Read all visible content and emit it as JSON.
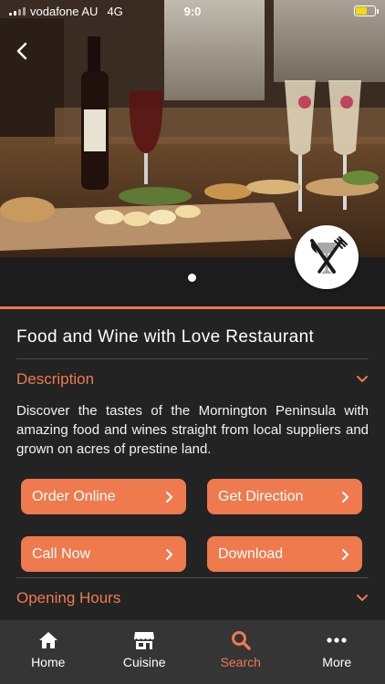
{
  "status": {
    "carrier": "vodafone AU",
    "network": "4G",
    "time": "9:0",
    "battery_level": 0.6
  },
  "colors": {
    "accent": "#ee7a4e",
    "background": "#232323",
    "tabbar": "#353535"
  },
  "hero": {
    "back_icon": "chevron-left-icon",
    "badge_icon": "knife-fork-wine-icon",
    "carousel_pages": 1,
    "carousel_active": 1
  },
  "restaurant": {
    "title": "Food and Wine with Love Restaurant"
  },
  "description": {
    "label": "Description",
    "text": "Discover the tastes of the Mornington Peninsula with amazing food and wines straight from local suppliers and grown on acres of prestine land."
  },
  "actions": [
    {
      "label": "Order Online"
    },
    {
      "label": "Get Direction"
    },
    {
      "label": "Call Now"
    },
    {
      "label": "Download"
    }
  ],
  "opening_hours": {
    "label": "Opening Hours"
  },
  "tabs": [
    {
      "label": "Home",
      "icon": "home-icon"
    },
    {
      "label": "Cuisine",
      "icon": "store-icon"
    },
    {
      "label": "Search",
      "icon": "search-icon",
      "active": true
    },
    {
      "label": "More",
      "icon": "more-dots-icon"
    }
  ]
}
